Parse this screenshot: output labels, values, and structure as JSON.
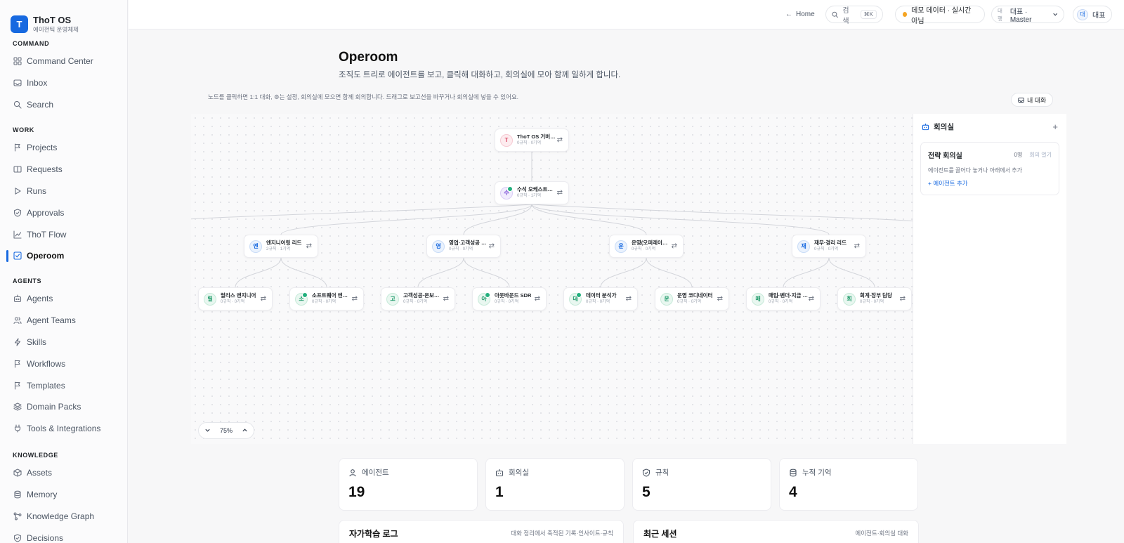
{
  "brand": {
    "logo": "T",
    "title": "ThoT OS",
    "subtitle": "에이전틱 운영체제"
  },
  "sidebar": {
    "sections": [
      {
        "label": "COMMAND",
        "items": [
          {
            "label": "Command Center",
            "icon": "grid-icon"
          },
          {
            "label": "Inbox",
            "icon": "inbox-icon"
          },
          {
            "label": "Search",
            "icon": "search-icon"
          }
        ]
      },
      {
        "label": "WORK",
        "items": [
          {
            "label": "Projects",
            "icon": "flag-icon"
          },
          {
            "label": "Requests",
            "icon": "book-icon"
          },
          {
            "label": "Runs",
            "icon": "play-icon"
          },
          {
            "label": "Approvals",
            "icon": "shield-check-icon"
          },
          {
            "label": "ThoT Flow",
            "icon": "chart-icon"
          },
          {
            "label": "Operoom",
            "icon": "operoom-icon",
            "active": true
          }
        ]
      },
      {
        "label": "AGENTS",
        "items": [
          {
            "label": "Agents",
            "icon": "bot-icon"
          },
          {
            "label": "Agent Teams",
            "icon": "users-icon"
          },
          {
            "label": "Skills",
            "icon": "bolt-icon"
          },
          {
            "label": "Workflows",
            "icon": "flag-icon"
          },
          {
            "label": "Templates",
            "icon": "flag-icon"
          },
          {
            "label": "Domain Packs",
            "icon": "layers-icon"
          },
          {
            "label": "Tools & Integrations",
            "icon": "plug-icon"
          }
        ]
      },
      {
        "label": "KNOWLEDGE",
        "items": [
          {
            "label": "Assets",
            "icon": "box-icon"
          },
          {
            "label": "Memory",
            "icon": "database-icon"
          },
          {
            "label": "Knowledge Graph",
            "icon": "graph-icon"
          },
          {
            "label": "Decisions",
            "icon": "shield-check-icon"
          }
        ]
      }
    ]
  },
  "topbar": {
    "home": "Home",
    "search": "검색",
    "search_kbd": "⌘K",
    "demo": "데모 데이터 · 실시간 아님",
    "role_label": "대행",
    "role_value": "대표 · Master",
    "user_initial": "대",
    "user_name": "대표"
  },
  "page": {
    "title": "Operoom",
    "description": "조직도 트리로 에이전트를 보고, 클릭해 대화하고, 회의실에 모아 함께 일하게 합니다.",
    "hint": "노드를 클릭하면 1:1 대화, ⚙는 설정, 회의실에 모으면 함께 회의합니다. 드래그로 보고선을 바꾸거나 회의실에 넣을 수 있어요.",
    "my_chat": "내 대화"
  },
  "org": {
    "nodes": [
      {
        "id": "root",
        "initial": "T",
        "name": "ThoT OS 거버…",
        "meta": "0규칙 · 0기억",
        "online": false,
        "tone": "rose"
      },
      {
        "id": "chief",
        "initial": "수",
        "name": "수석 오케스트…",
        "meta": "0규칙 · 1기억",
        "online": true,
        "tone": "violet"
      },
      {
        "id": "eng",
        "initial": "엔",
        "name": "엔지니어링 리드",
        "meta": "2규칙 · 1기억",
        "online": false,
        "tone": "blue"
      },
      {
        "id": "sales",
        "initial": "영",
        "name": "영업·고객성공 …",
        "meta": "0규칙 · 0기억",
        "online": false,
        "tone": "blue"
      },
      {
        "id": "ops",
        "initial": "운",
        "name": "운영(오퍼레이…",
        "meta": "0규칙 · 0기억",
        "online": false,
        "tone": "blue"
      },
      {
        "id": "fin",
        "initial": "재",
        "name": "재무·경리 리드",
        "meta": "0규칙 · 0기억",
        "online": false,
        "tone": "blue"
      },
      {
        "id": "qa",
        "initial": "릴",
        "name": "릴리스 엔지니어",
        "meta": "0규칙 · 0기억",
        "online": false,
        "tone": "green"
      },
      {
        "id": "sw",
        "initial": "소",
        "name": "소프트웨어 엔…",
        "meta": "0규칙 · 0기억",
        "online": true,
        "tone": "green"
      },
      {
        "id": "cs",
        "initial": "고",
        "name": "고객성공·온보…",
        "meta": "0규칙 · 0기억",
        "online": false,
        "tone": "green"
      },
      {
        "id": "sdr",
        "initial": "아",
        "name": "아웃바운드 SDR",
        "meta": "0규칙 · 0기억",
        "online": true,
        "tone": "green"
      },
      {
        "id": "da",
        "initial": "데",
        "name": "데이터 분석가",
        "meta": "0규칙 · 0기억",
        "online": true,
        "tone": "green"
      },
      {
        "id": "oc",
        "initial": "운",
        "name": "운영 코디네이터",
        "meta": "0규칙 · 0기억",
        "online": false,
        "tone": "green"
      },
      {
        "id": "ap",
        "initial": "매",
        "name": "매입·벤더·지급 …",
        "meta": "0규칙 · 0기억",
        "online": false,
        "tone": "green"
      },
      {
        "id": "acc",
        "initial": "회",
        "name": "회계·장부 담당",
        "meta": "0규칙 · 0기억",
        "online": false,
        "tone": "green"
      }
    ],
    "zoom": "75%"
  },
  "meeting": {
    "title": "회의실",
    "room_name": "전략 회의실",
    "count": "0명",
    "open_label": "회의 열기",
    "description": "에이전트를 끌어다 놓거나 아래에서 추가",
    "add_label": "+ 에이전트 추가"
  },
  "stats": [
    {
      "label": "에이전트",
      "value": "19",
      "icon": "user-icon"
    },
    {
      "label": "회의실",
      "value": "1",
      "icon": "bot-icon"
    },
    {
      "label": "규칙",
      "value": "5",
      "icon": "shield-check-icon"
    },
    {
      "label": "누적 기억",
      "value": "4",
      "icon": "database-icon"
    }
  ],
  "panels": [
    {
      "title": "자가학습 로그",
      "subtitle": "대화 정리에서 축적된 기록·인사이트·규칙"
    },
    {
      "title": "최근 세션",
      "subtitle": "에이전트·회의실 대화"
    }
  ],
  "colors": {
    "accent": "#1769e0",
    "online": "#22b07d",
    "demo_dot": "#f5a524"
  }
}
